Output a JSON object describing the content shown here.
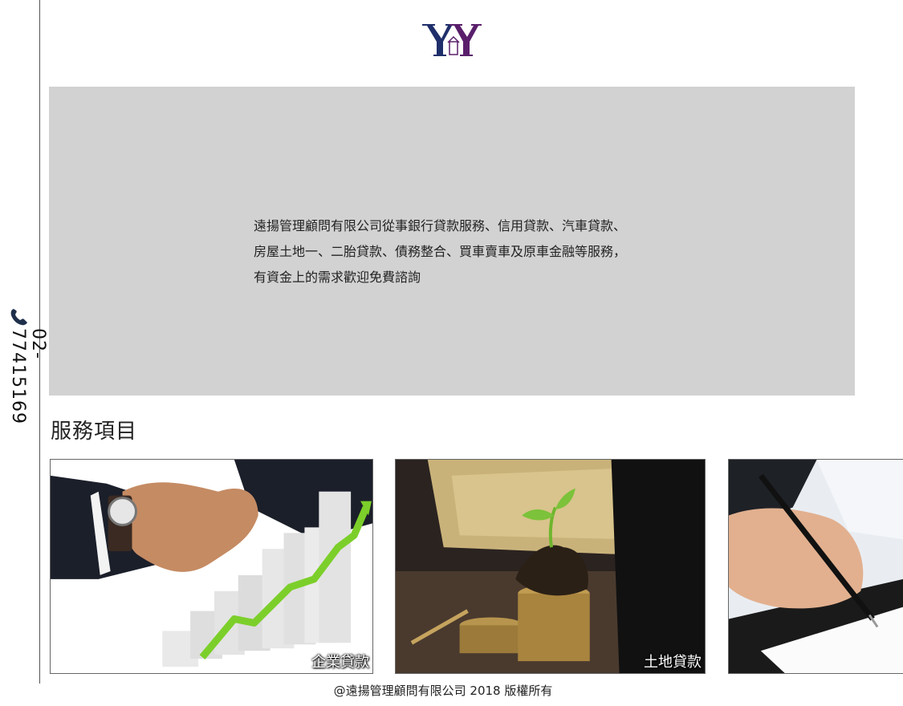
{
  "sidebar": {
    "phone_icon": "phone-icon",
    "phone_number": "02-77415169"
  },
  "header": {
    "logo_text": "YY",
    "logo_colors": {
      "primary": "#1f2f6b",
      "secondary": "#5a1f6b"
    }
  },
  "hero": {
    "background": "#d2d2d2",
    "lines": [
      "遠揚管理顧問有限公司從事銀行貸款服務、信用貸款、汽車貸款、",
      "房屋土地一、二胎貸款、債務整合、買車賣車及原車金融等服務，",
      "有資金上的需求歡迎免費諮詢"
    ]
  },
  "services": {
    "title": "服務項目",
    "cards": [
      {
        "label": "企業貸款",
        "image": "handshake-growth-chart"
      },
      {
        "label": "土地貸款",
        "image": "seedling-on-coins"
      },
      {
        "label": "",
        "image": "hand-signing-document"
      }
    ]
  },
  "footer": {
    "copyright": "@遠揚管理顧問有限公司 2018  版權所有"
  }
}
